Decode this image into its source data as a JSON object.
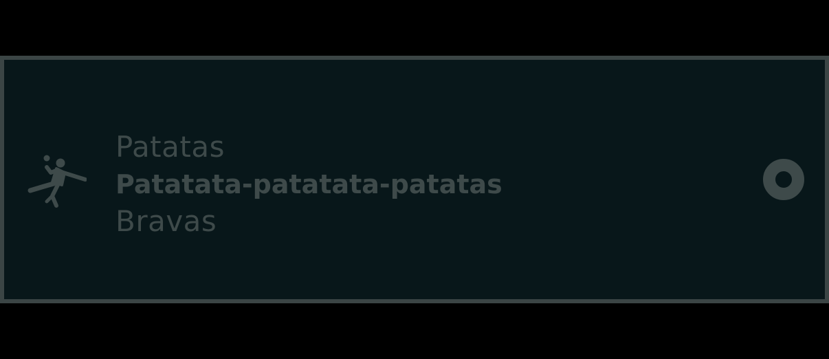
{
  "item": {
    "icon": "handball-player-icon",
    "overline": "Patatas",
    "headline": "Patatata-patatata-patatas",
    "supporting": "Bravas",
    "selected": true
  },
  "colors": {
    "background": "#000000",
    "card": "#08171a",
    "border": "#3b4545",
    "foreground": "#3e4a4a"
  }
}
